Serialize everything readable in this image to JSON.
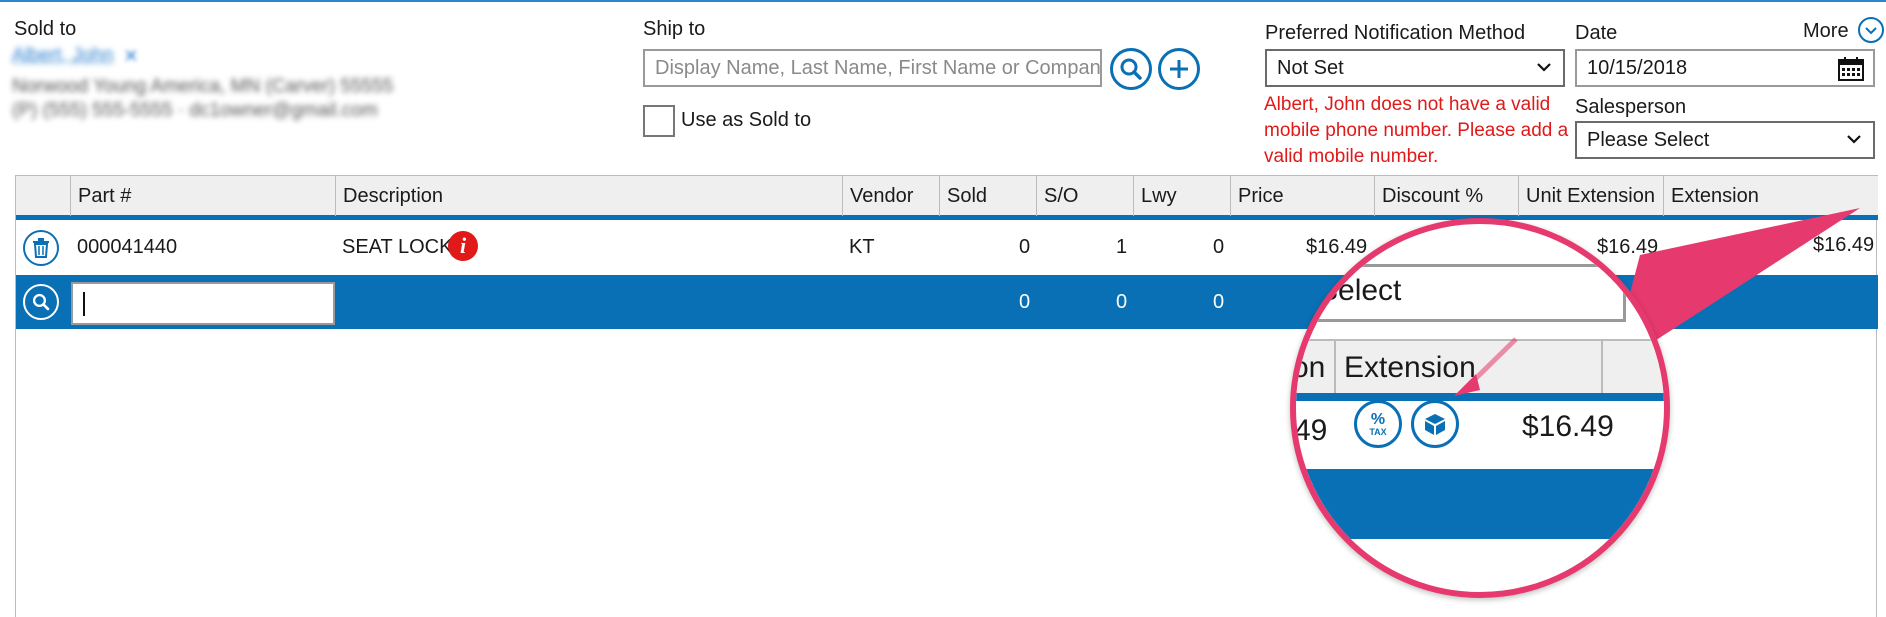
{
  "sold_to": {
    "label": "Sold to",
    "customer_name": "Albert, John",
    "address_line": "Norwood Young America, MN (Carver) 55555",
    "contact_line": "(P) (555) 555-5555 · dc1owner@gmail.com"
  },
  "ship_to": {
    "label": "Ship to",
    "placeholder": "Display Name, Last Name, First Name or Company",
    "use_as_sold_to_label": "Use as Sold to"
  },
  "notification": {
    "label": "Preferred Notification Method",
    "value": "Not Set",
    "error": "Albert, John does not have a valid mobile phone number. Please add a valid mobile number."
  },
  "date": {
    "label": "Date",
    "value": "10/15/2018"
  },
  "more_label": "More",
  "salesperson": {
    "label": "Salesperson",
    "value": "Please Select"
  },
  "grid": {
    "headers": [
      "Part #",
      "Description",
      "Vendor",
      "Sold",
      "S/O",
      "Lwy",
      "Price",
      "Discount %",
      "Unit Extension",
      "Extension"
    ],
    "row1": {
      "part": "000041440",
      "description": "SEAT LOCK",
      "vendor": "KT",
      "sold": "0",
      "so": "1",
      "lwy": "0",
      "price": "$16.49",
      "unit_extension": "$16.49",
      "extension": "$16.49"
    },
    "entry_row": {
      "sold": "0",
      "so": "0",
      "lwy": "0"
    }
  },
  "zoom": {
    "select_text": "Select",
    "col_partial": "on",
    "extension_label": "Extension",
    "partial_value": "49",
    "tax_label": "TAX",
    "extension_value": "$16.49"
  },
  "colors": {
    "accent": "#0a70b5",
    "error": "#e01919",
    "callout": "#e63a6e"
  }
}
